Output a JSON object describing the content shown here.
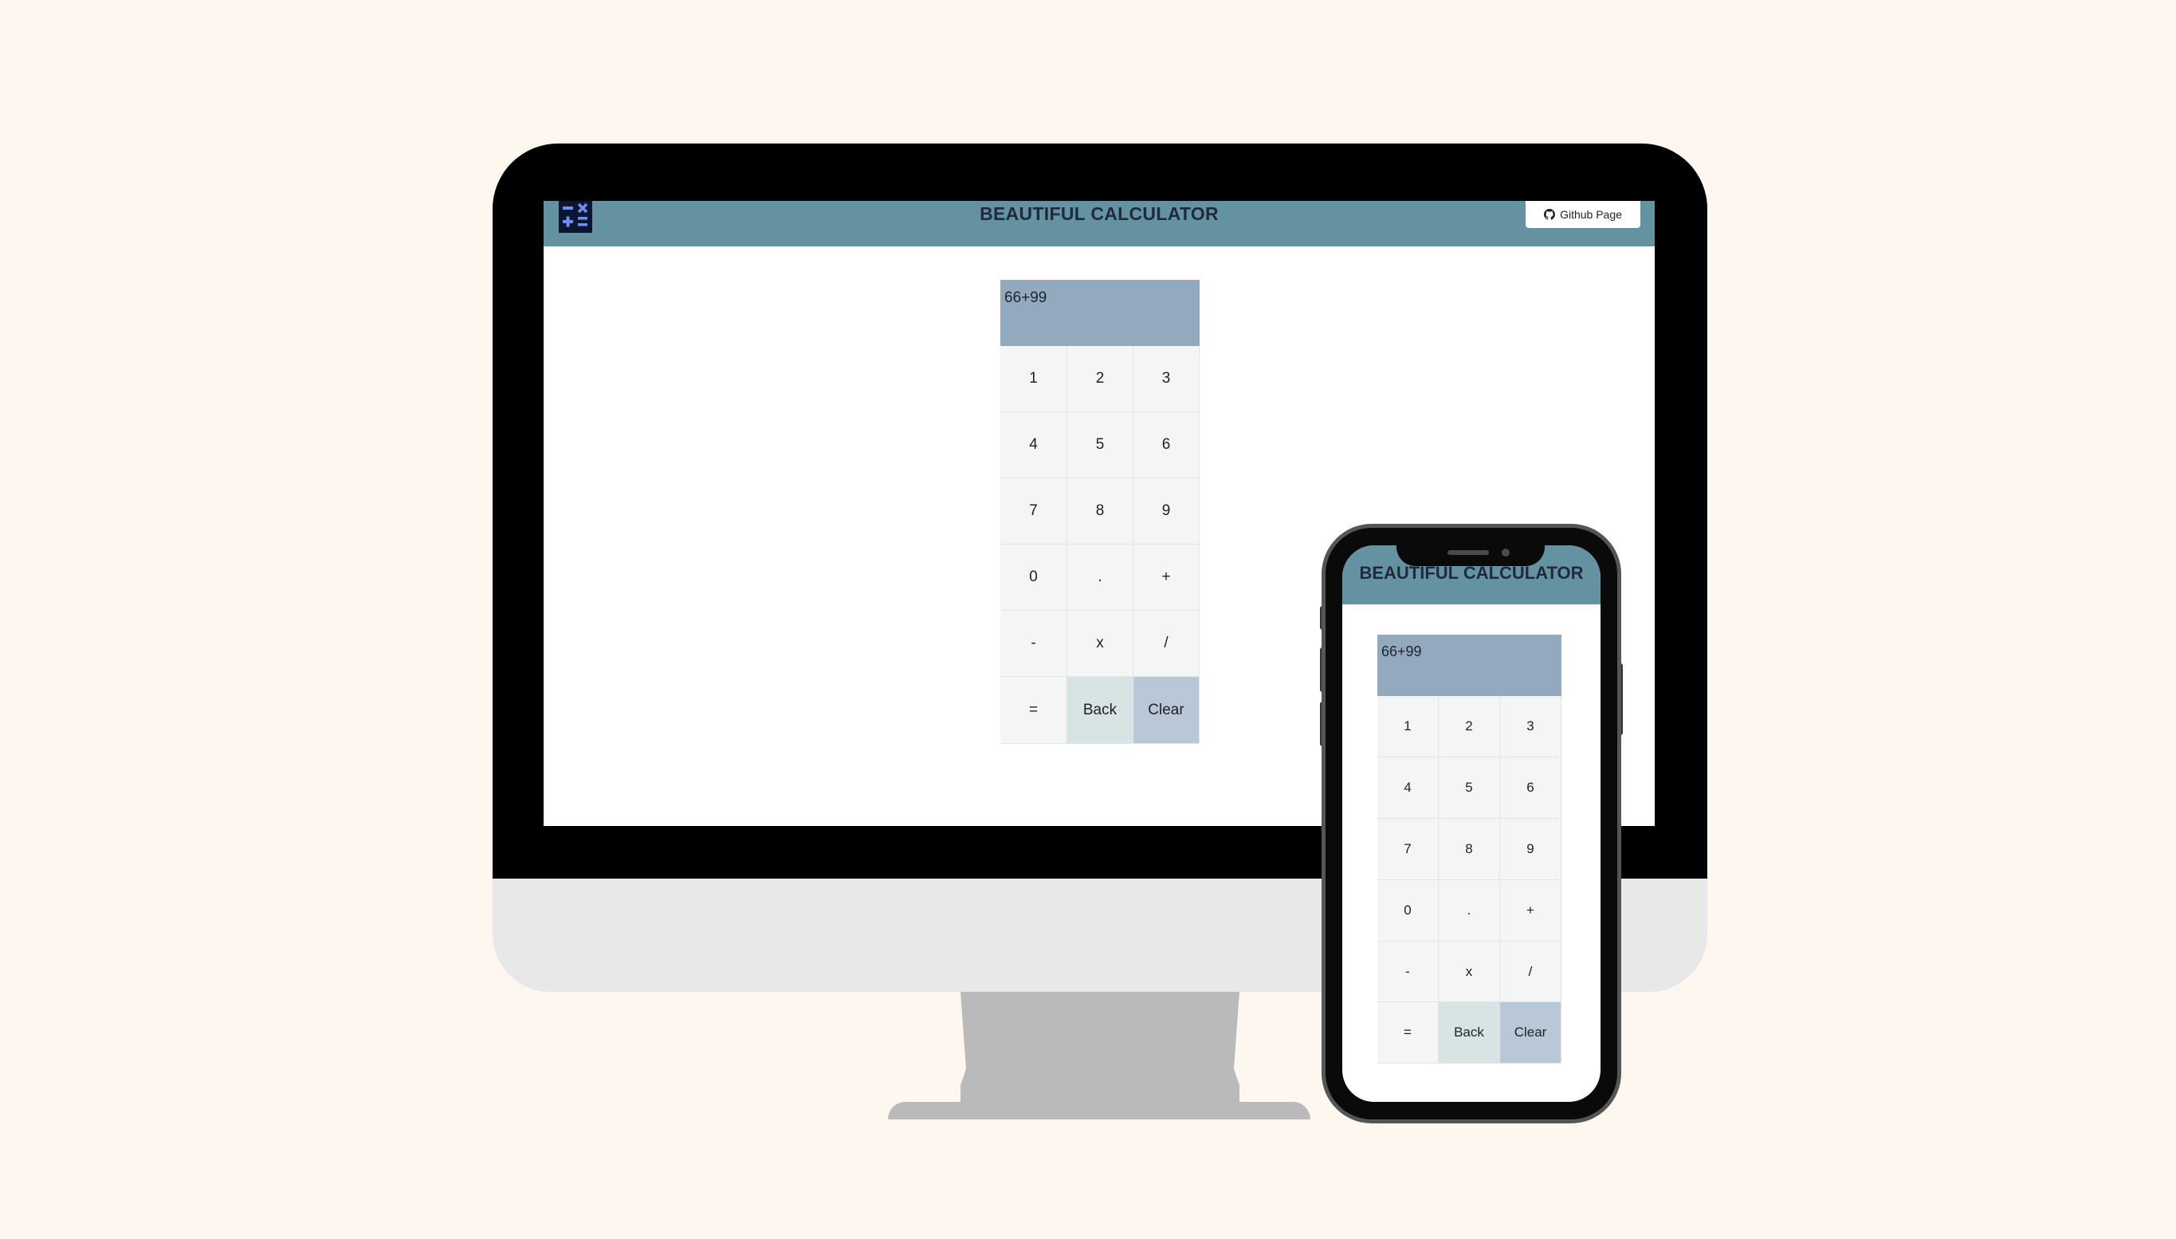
{
  "desktop": {
    "title": "BEAUTIFUL CALCULATOR",
    "github_button": "Github Page",
    "logo_icon": "calculator-icon",
    "github_icon": "github-icon",
    "display": "66+99"
  },
  "phone": {
    "title": "BEAUTIFUL CALCULATOR",
    "display": "66+99"
  },
  "keys": [
    "1",
    "2",
    "3",
    "4",
    "5",
    "6",
    "7",
    "8",
    "9",
    "0",
    ".",
    "+",
    "-",
    "x",
    "/",
    "=",
    "Back",
    "Clear"
  ],
  "colors": {
    "background": "#fef7f0",
    "header": "#6492a1",
    "display": "#93a9bd",
    "key": "#f3f6f5",
    "back_key": "#d8e4e4",
    "clear_key": "#b8c8d6"
  }
}
